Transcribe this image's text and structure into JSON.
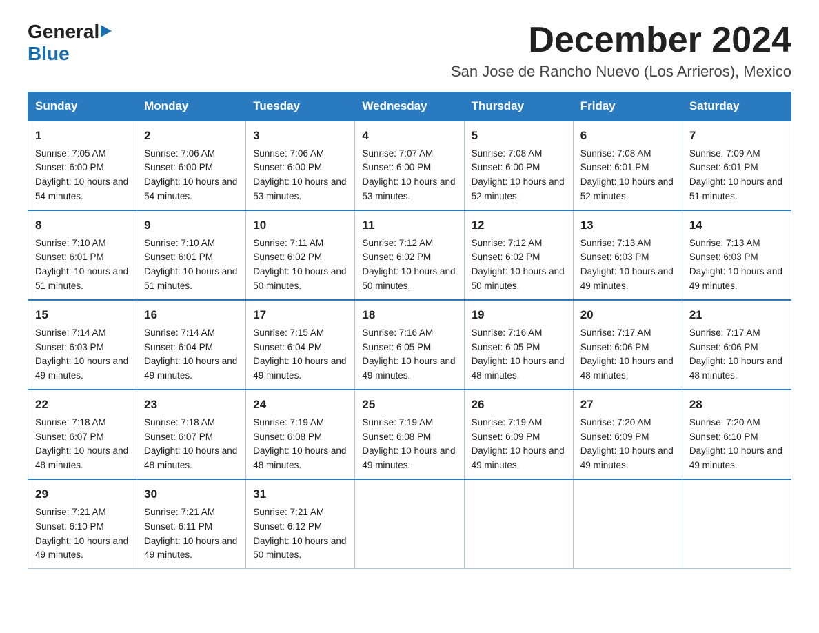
{
  "header": {
    "logo_general": "General",
    "logo_blue": "Blue",
    "month_title": "December 2024",
    "location": "San Jose de Rancho Nuevo (Los Arrieros), Mexico"
  },
  "days_of_week": [
    "Sunday",
    "Monday",
    "Tuesday",
    "Wednesday",
    "Thursday",
    "Friday",
    "Saturday"
  ],
  "weeks": [
    [
      {
        "day": "1",
        "sunrise": "7:05 AM",
        "sunset": "6:00 PM",
        "daylight": "10 hours and 54 minutes."
      },
      {
        "day": "2",
        "sunrise": "7:06 AM",
        "sunset": "6:00 PM",
        "daylight": "10 hours and 54 minutes."
      },
      {
        "day": "3",
        "sunrise": "7:06 AM",
        "sunset": "6:00 PM",
        "daylight": "10 hours and 53 minutes."
      },
      {
        "day": "4",
        "sunrise": "7:07 AM",
        "sunset": "6:00 PM",
        "daylight": "10 hours and 53 minutes."
      },
      {
        "day": "5",
        "sunrise": "7:08 AM",
        "sunset": "6:00 PM",
        "daylight": "10 hours and 52 minutes."
      },
      {
        "day": "6",
        "sunrise": "7:08 AM",
        "sunset": "6:01 PM",
        "daylight": "10 hours and 52 minutes."
      },
      {
        "day": "7",
        "sunrise": "7:09 AM",
        "sunset": "6:01 PM",
        "daylight": "10 hours and 51 minutes."
      }
    ],
    [
      {
        "day": "8",
        "sunrise": "7:10 AM",
        "sunset": "6:01 PM",
        "daylight": "10 hours and 51 minutes."
      },
      {
        "day": "9",
        "sunrise": "7:10 AM",
        "sunset": "6:01 PM",
        "daylight": "10 hours and 51 minutes."
      },
      {
        "day": "10",
        "sunrise": "7:11 AM",
        "sunset": "6:02 PM",
        "daylight": "10 hours and 50 minutes."
      },
      {
        "day": "11",
        "sunrise": "7:12 AM",
        "sunset": "6:02 PM",
        "daylight": "10 hours and 50 minutes."
      },
      {
        "day": "12",
        "sunrise": "7:12 AM",
        "sunset": "6:02 PM",
        "daylight": "10 hours and 50 minutes."
      },
      {
        "day": "13",
        "sunrise": "7:13 AM",
        "sunset": "6:03 PM",
        "daylight": "10 hours and 49 minutes."
      },
      {
        "day": "14",
        "sunrise": "7:13 AM",
        "sunset": "6:03 PM",
        "daylight": "10 hours and 49 minutes."
      }
    ],
    [
      {
        "day": "15",
        "sunrise": "7:14 AM",
        "sunset": "6:03 PM",
        "daylight": "10 hours and 49 minutes."
      },
      {
        "day": "16",
        "sunrise": "7:14 AM",
        "sunset": "6:04 PM",
        "daylight": "10 hours and 49 minutes."
      },
      {
        "day": "17",
        "sunrise": "7:15 AM",
        "sunset": "6:04 PM",
        "daylight": "10 hours and 49 minutes."
      },
      {
        "day": "18",
        "sunrise": "7:16 AM",
        "sunset": "6:05 PM",
        "daylight": "10 hours and 49 minutes."
      },
      {
        "day": "19",
        "sunrise": "7:16 AM",
        "sunset": "6:05 PM",
        "daylight": "10 hours and 48 minutes."
      },
      {
        "day": "20",
        "sunrise": "7:17 AM",
        "sunset": "6:06 PM",
        "daylight": "10 hours and 48 minutes."
      },
      {
        "day": "21",
        "sunrise": "7:17 AM",
        "sunset": "6:06 PM",
        "daylight": "10 hours and 48 minutes."
      }
    ],
    [
      {
        "day": "22",
        "sunrise": "7:18 AM",
        "sunset": "6:07 PM",
        "daylight": "10 hours and 48 minutes."
      },
      {
        "day": "23",
        "sunrise": "7:18 AM",
        "sunset": "6:07 PM",
        "daylight": "10 hours and 48 minutes."
      },
      {
        "day": "24",
        "sunrise": "7:19 AM",
        "sunset": "6:08 PM",
        "daylight": "10 hours and 48 minutes."
      },
      {
        "day": "25",
        "sunrise": "7:19 AM",
        "sunset": "6:08 PM",
        "daylight": "10 hours and 49 minutes."
      },
      {
        "day": "26",
        "sunrise": "7:19 AM",
        "sunset": "6:09 PM",
        "daylight": "10 hours and 49 minutes."
      },
      {
        "day": "27",
        "sunrise": "7:20 AM",
        "sunset": "6:09 PM",
        "daylight": "10 hours and 49 minutes."
      },
      {
        "day": "28",
        "sunrise": "7:20 AM",
        "sunset": "6:10 PM",
        "daylight": "10 hours and 49 minutes."
      }
    ],
    [
      {
        "day": "29",
        "sunrise": "7:21 AM",
        "sunset": "6:10 PM",
        "daylight": "10 hours and 49 minutes."
      },
      {
        "day": "30",
        "sunrise": "7:21 AM",
        "sunset": "6:11 PM",
        "daylight": "10 hours and 49 minutes."
      },
      {
        "day": "31",
        "sunrise": "7:21 AM",
        "sunset": "6:12 PM",
        "daylight": "10 hours and 50 minutes."
      },
      null,
      null,
      null,
      null
    ]
  ],
  "labels": {
    "sunrise": "Sunrise:",
    "sunset": "Sunset:",
    "daylight": "Daylight:"
  }
}
